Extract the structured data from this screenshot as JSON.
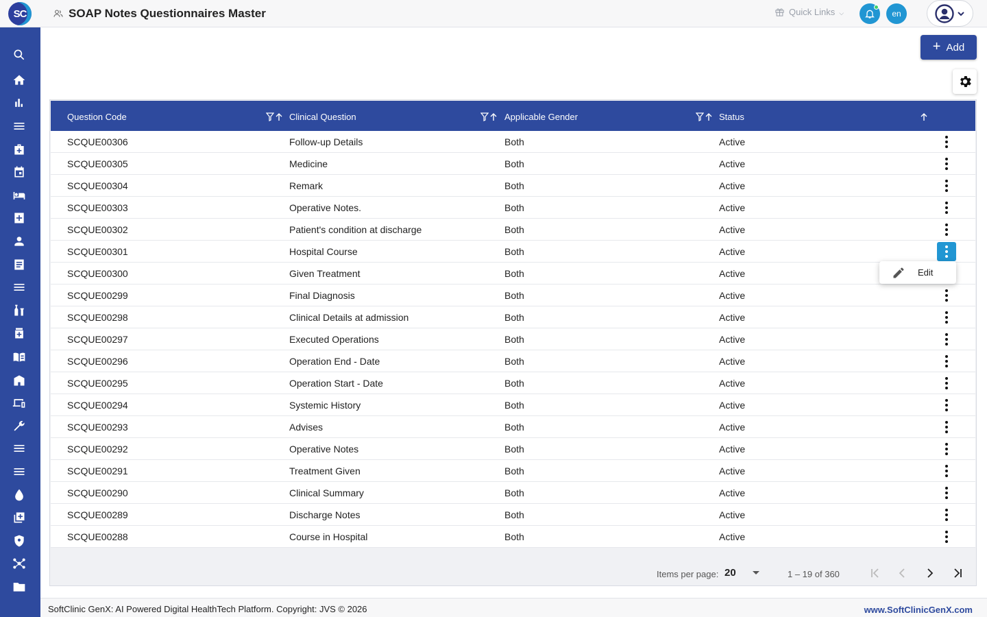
{
  "app": {
    "logo_text": "SC",
    "page_title": "SOAP Notes Questionnaires Master",
    "quick_links": "Quick Links",
    "lang": "en"
  },
  "sidebar": {
    "icons": [
      "search-icon",
      "home-icon",
      "bar-chart-icon",
      "menu-icon",
      "medical-bag-icon",
      "calendar-icon",
      "bed-icon",
      "medical-plus-icon",
      "person-icon",
      "document-icon",
      "menu-icon",
      "lab-icon",
      "pharmacy-icon",
      "book-icon",
      "building-icon",
      "devices-icon",
      "wrench-icon",
      "menu-icon",
      "menu-icon",
      "water-drop-icon",
      "add-box-icon",
      "shield-icon",
      "hub-icon",
      "folder-icon"
    ]
  },
  "toolbar": {
    "add_label": "Add"
  },
  "table": {
    "columns": [
      "Question Code",
      "Clinical Question",
      "Applicable Gender",
      "Status"
    ],
    "rows": [
      {
        "code": "SCQUE00306",
        "question": "Follow-up Details",
        "gender": "Both",
        "status": "Active"
      },
      {
        "code": "SCQUE00305",
        "question": "Medicine",
        "gender": "Both",
        "status": "Active"
      },
      {
        "code": "SCQUE00304",
        "question": "Remark",
        "gender": "Both",
        "status": "Active"
      },
      {
        "code": "SCQUE00303",
        "question": "Operative Notes.",
        "gender": "Both",
        "status": "Active"
      },
      {
        "code": "SCQUE00302",
        "question": "Patient's condition at discharge",
        "gender": "Both",
        "status": "Active"
      },
      {
        "code": "SCQUE00301",
        "question": "Hospital Course",
        "gender": "Both",
        "status": "Active"
      },
      {
        "code": "SCQUE00300",
        "question": "Given Treatment",
        "gender": "Both",
        "status": "Active"
      },
      {
        "code": "SCQUE00299",
        "question": "Final Diagnosis",
        "gender": "Both",
        "status": "Active"
      },
      {
        "code": "SCQUE00298",
        "question": "Clinical Details at admission",
        "gender": "Both",
        "status": "Active"
      },
      {
        "code": "SCQUE00297",
        "question": "Executed Operations",
        "gender": "Both",
        "status": "Active"
      },
      {
        "code": "SCQUE00296",
        "question": "Operation End - Date",
        "gender": "Both",
        "status": "Active"
      },
      {
        "code": "SCQUE00295",
        "question": "Operation Start - Date",
        "gender": "Both",
        "status": "Active"
      },
      {
        "code": "SCQUE00294",
        "question": "Systemic History",
        "gender": "Both",
        "status": "Active"
      },
      {
        "code": "SCQUE00293",
        "question": "Advises",
        "gender": "Both",
        "status": "Active"
      },
      {
        "code": "SCQUE00292",
        "question": "Operative Notes",
        "gender": "Both",
        "status": "Active"
      },
      {
        "code": "SCQUE00291",
        "question": "Treatment Given",
        "gender": "Both",
        "status": "Active"
      },
      {
        "code": "SCQUE00290",
        "question": "Clinical Summary",
        "gender": "Both",
        "status": "Active"
      },
      {
        "code": "SCQUE00289",
        "question": "Discharge Notes",
        "gender": "Both",
        "status": "Active"
      },
      {
        "code": "SCQUE00288",
        "question": "Course in Hospital",
        "gender": "Both",
        "status": "Active"
      }
    ],
    "active_row": 5,
    "row_menu": {
      "edit_label": "Edit"
    }
  },
  "paginator": {
    "items_per_page_label": "Items per page:",
    "page_size": "20",
    "range_label": "1 – 19 of 360"
  },
  "footer": {
    "copyright": "SoftClinic GenX: AI Powered Digital HealthTech Platform. Copyright: JVS © 2026",
    "website": "www.SoftClinicGenX.com"
  },
  "colors": {
    "brand": "#2e4a9e",
    "accent": "#2196d3"
  }
}
